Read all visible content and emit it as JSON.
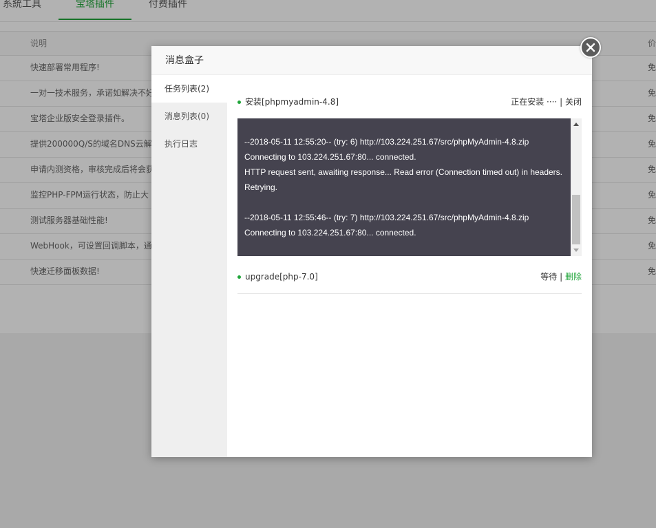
{
  "background": {
    "tabs": [
      "系統工具",
      "宝塔插件",
      "付费插件"
    ],
    "active_tab": "宝塔插件",
    "table": {
      "header": {
        "desc": "说明",
        "price": "价"
      },
      "rows": [
        {
          "desc": "快速部署常用程序!",
          "price": "免"
        },
        {
          "desc": "一对一技术服务，承诺如解决不好",
          "price": "免"
        },
        {
          "desc": "宝塔企业版安全登录插件。",
          "price": "免"
        },
        {
          "desc": "提供200000Q/S的域名DNS云解析",
          "price": "免"
        },
        {
          "desc": "申请内测资格，审核完成后将会获",
          "price": "免"
        },
        {
          "desc": "监控PHP-FPM运行状态，防止大",
          "price": "免"
        },
        {
          "desc": "测试服务器基础性能!",
          "price": "免"
        },
        {
          "desc": "WebHook，可设置回调脚本，通",
          "price": "免"
        },
        {
          "desc": "快速迁移面板数据!",
          "price": "免"
        }
      ]
    }
  },
  "dialog": {
    "title": "消息盒子",
    "close_icon": "close-icon",
    "sidebar": [
      {
        "label": "任务列表(2)",
        "active": true
      },
      {
        "label": "消息列表(0)",
        "active": false
      },
      {
        "label": "执行日志",
        "active": false
      }
    ],
    "tasks": [
      {
        "name": "安装[phpmyadmin-4.8]",
        "status": "正在安装 ····",
        "separator": " | ",
        "action": "关闭",
        "log": [
          "",
          "--2018-05-11 12:55:20-- (try: 6) http://103.224.251.67/src/phpMyAdmin-4.8.zip",
          "Connecting to 103.224.251.67:80... connected.",
          "HTTP request sent, awaiting response... Read error (Connection timed out) in headers.",
          "Retrying.",
          "",
          "--2018-05-11 12:55:46-- (try: 7) http://103.224.251.67/src/phpMyAdmin-4.8.zip",
          "Connecting to 103.224.251.67:80... connected."
        ]
      },
      {
        "name": "upgrade[php-7.0]",
        "status": "等待",
        "separator": " | ",
        "action": "删除"
      }
    ]
  },
  "colors": {
    "accent": "#20a53a",
    "log_background": "#45434f",
    "sidebar_background": "#efefef"
  }
}
